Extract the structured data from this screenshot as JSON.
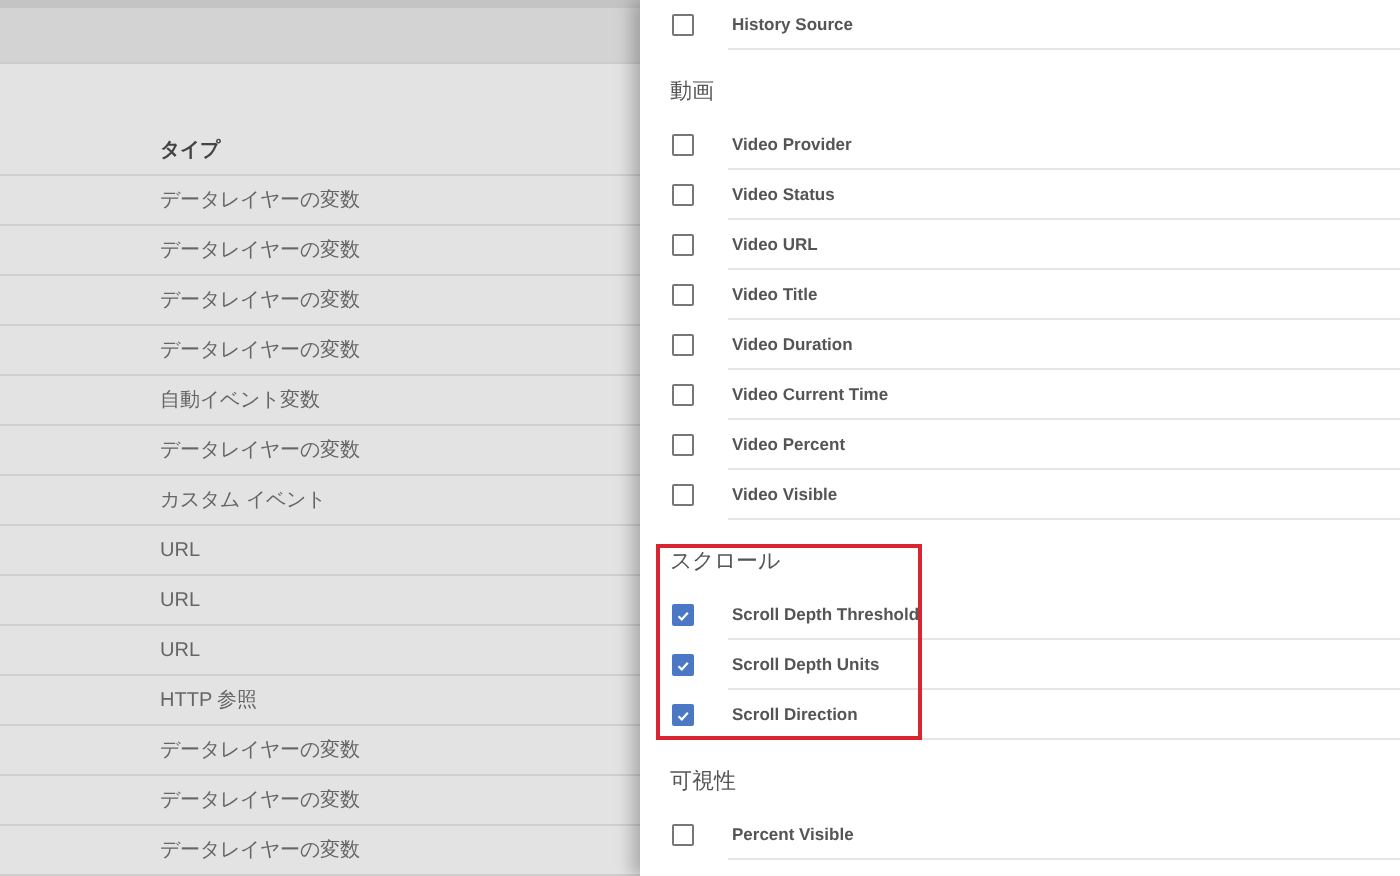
{
  "table": {
    "columns": [
      "タイプ"
    ],
    "rows": [
      "データレイヤーの変数",
      "データレイヤーの変数",
      "データレイヤーの変数",
      "データレイヤーの変数",
      "自動イベント変数",
      "データレイヤーの変数",
      "カスタム イベント",
      "URL",
      "URL",
      "URL",
      "HTTP 参照",
      "データレイヤーの変数",
      "データレイヤーの変数",
      "データレイヤーの変数"
    ]
  },
  "panel": {
    "sections": [
      {
        "highlighted": false,
        "items": [
          {
            "label": "History Source",
            "checked": false
          }
        ]
      },
      {
        "heading": "動画",
        "highlighted": false,
        "items": [
          {
            "label": "Video Provider",
            "checked": false
          },
          {
            "label": "Video Status",
            "checked": false
          },
          {
            "label": "Video URL",
            "checked": false
          },
          {
            "label": "Video Title",
            "checked": false
          },
          {
            "label": "Video Duration",
            "checked": false
          },
          {
            "label": "Video Current Time",
            "checked": false
          },
          {
            "label": "Video Percent",
            "checked": false
          },
          {
            "label": "Video Visible",
            "checked": false
          }
        ]
      },
      {
        "heading": "スクロール",
        "highlighted": true,
        "items": [
          {
            "label": "Scroll Depth Threshold",
            "checked": true
          },
          {
            "label": "Scroll Depth Units",
            "checked": true
          },
          {
            "label": "Scroll Direction",
            "checked": true
          }
        ]
      },
      {
        "heading": "可視性",
        "highlighted": false,
        "items": [
          {
            "label": "Percent Visible",
            "checked": false
          }
        ]
      }
    ]
  }
}
